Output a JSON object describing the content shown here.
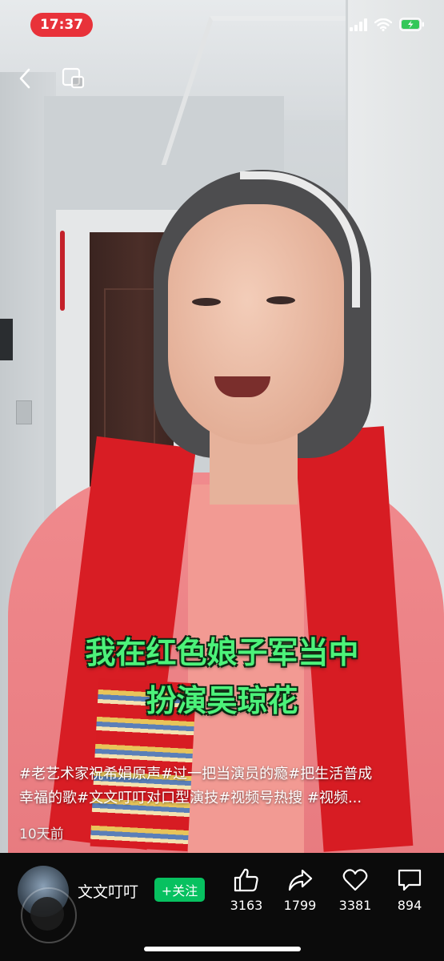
{
  "status_bar": {
    "time": "17:37"
  },
  "overlay": {
    "subtitle_line1": "我在红色娘子军当中",
    "subtitle_line2": "扮演吴琼花",
    "description_line1": "#老艺术家祝希娟原声#过一把当演员的瘾#把生活普成",
    "description_line2": "幸福的歌#文文叮叮对口型演技#视频号热搜 #视频...",
    "posted": "10天前"
  },
  "bottom_bar": {
    "author_name": "文文叮叮",
    "follow_label": "+关注",
    "like_count": "3163",
    "share_count": "1799",
    "favorite_count": "3381",
    "comment_count": "894"
  },
  "colors": {
    "time_pill": "#e8323a",
    "follow_button": "#07c160",
    "subtitle_text": "#4cf27a"
  },
  "icons": [
    "back-icon",
    "float-window-icon",
    "signal-icon",
    "wifi-icon",
    "battery-icon",
    "thumbs-up-icon",
    "share-icon",
    "heart-icon",
    "comment-icon"
  ]
}
